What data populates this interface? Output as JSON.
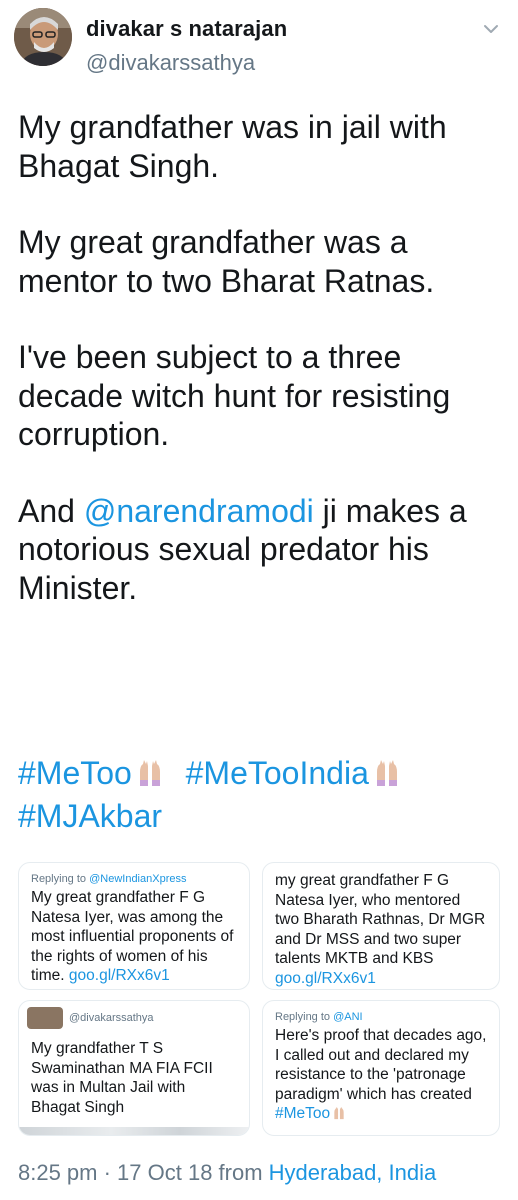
{
  "author": {
    "display_name": "divakar s natarajan",
    "handle": "@divakarssathya"
  },
  "tweet": {
    "para1": "My grandfather was in jail with Bhagat Singh.",
    "para2": "My great grandfather was a mentor to two Bharat Ratnas.",
    "para3": "I've been subject to a three decade witch hunt for resisting corruption.",
    "para4_before": "And ",
    "para4_mention": "@narendramodi",
    "para4_after": " ji makes a notorious sexual predator his Minister.",
    "hashtags": [
      "#MeToo",
      "#MeTooIndia",
      "#MJAkbar"
    ]
  },
  "embedded_cards": {
    "card1": {
      "replying_prefix": "Replying to ",
      "replying_to": "@NewIndianXpress",
      "text": "My great grandfather F G Natesa Iyer, was among the most influential proponents of the rights of women of his time. ",
      "link": "goo.gl/RXx6v1"
    },
    "card2": {
      "text": "my great grandfather F G Natesa Iyer, who mentored two Bharath Rathnas, Dr MGR and Dr MSS and two super talents MKTB and KBS ",
      "link": "goo.gl/RXx6v1"
    },
    "card3": {
      "handle": "@divakarssathya",
      "text": "My grandfather T S Swaminathan MA FIA FCII was in Multan Jail with Bhagat Singh"
    },
    "card4": {
      "replying_prefix": "Replying to ",
      "replying_to": "@ANI",
      "text": "Here's proof that decades ago, I called out and declared my resistance to the 'patronage paradigm' which has created ",
      "hashtag": "#MeToo"
    }
  },
  "meta": {
    "timestamp": "8:25 pm · 17 Oct 18 from ",
    "location": "Hyderabad, India"
  },
  "colors": {
    "link": "#1b95e0",
    "secondary_text": "#657786",
    "primary_text": "#14171a"
  },
  "icons": [
    "chevron-down-icon",
    "raised-hands-icon"
  ]
}
